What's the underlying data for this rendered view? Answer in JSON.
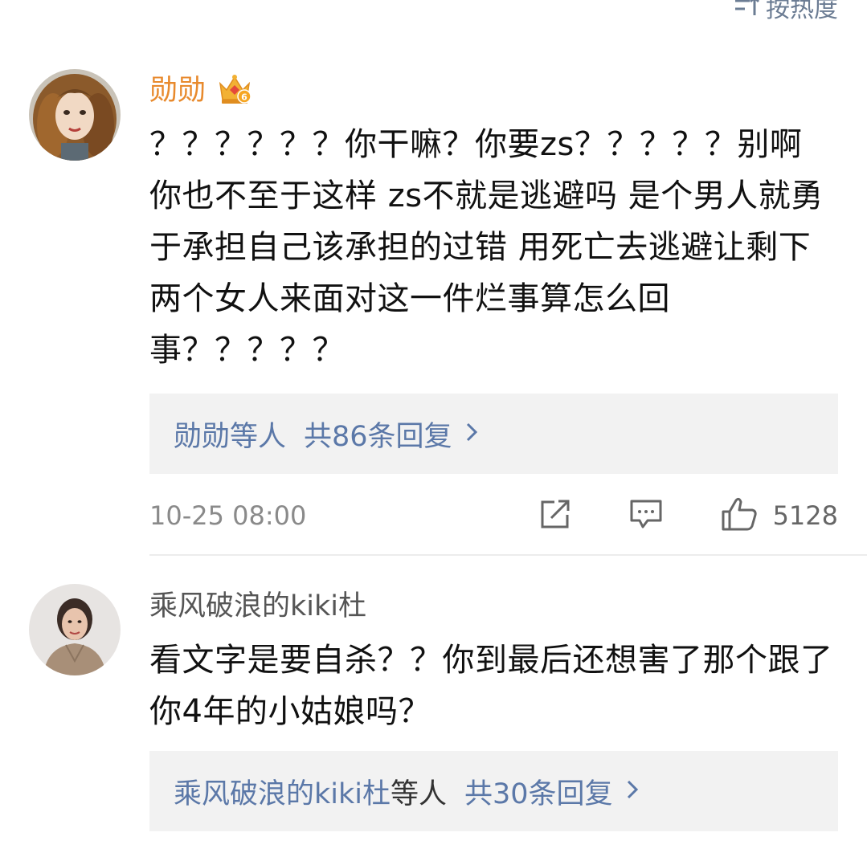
{
  "sort": {
    "label": "按热度"
  },
  "comments": [
    {
      "username": "勋勋",
      "vip_badge": "6",
      "text": "？？？？？？你干嘛？你要zs？？？？？别啊 你也不至于这样 zs不就是逃避吗 是个男人就勇于承担自己该承担的过错 用死亡去逃避让剩下两个女人来面对这一件烂事算怎么回事？？？？？",
      "replies_users": "勋勋等人",
      "replies_count": "共86条回复",
      "time": "10-25 08:00",
      "likes": "5128"
    },
    {
      "username": "乘风破浪的kiki杜",
      "text": "看文字是要自杀？？你到最后还想害了那个跟了你4年的小姑娘吗？",
      "replies_users_name": "乘风破浪的kiki杜",
      "replies_users_suffix": "等人",
      "replies_count": "共30条回复"
    }
  ],
  "colors": {
    "vip_name": "#e88a2d",
    "link": "#5b78a8",
    "reply_bg": "#f2f2f2"
  }
}
